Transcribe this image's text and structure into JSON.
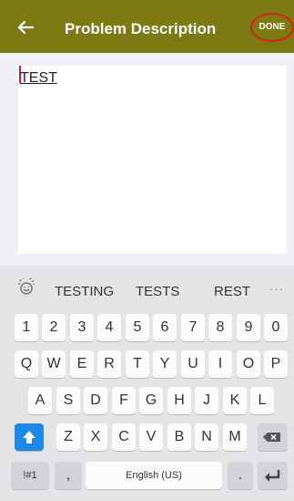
{
  "appbar": {
    "title": "Problem Description",
    "done_label": "DONE",
    "back_icon": "arrow-left-icon"
  },
  "editor": {
    "text": "TEST"
  },
  "keyboard": {
    "suggestions": [
      "TESTING",
      "TESTS",
      "REST"
    ],
    "more": "···",
    "number_row": [
      "1",
      "2",
      "3",
      "4",
      "5",
      "6",
      "7",
      "8",
      "9",
      "0"
    ],
    "row1": [
      "Q",
      "W",
      "E",
      "R",
      "T",
      "Y",
      "U",
      "I",
      "O",
      "P"
    ],
    "row2": [
      "A",
      "S",
      "D",
      "F",
      "G",
      "H",
      "J",
      "K",
      "L"
    ],
    "row3": [
      "Z",
      "X",
      "C",
      "V",
      "B",
      "N",
      "M"
    ],
    "symbols_label": "!#1",
    "comma_label": ",",
    "space_label": "English (US)",
    "period_label": ".",
    "shift_color": "#1e88e5"
  }
}
